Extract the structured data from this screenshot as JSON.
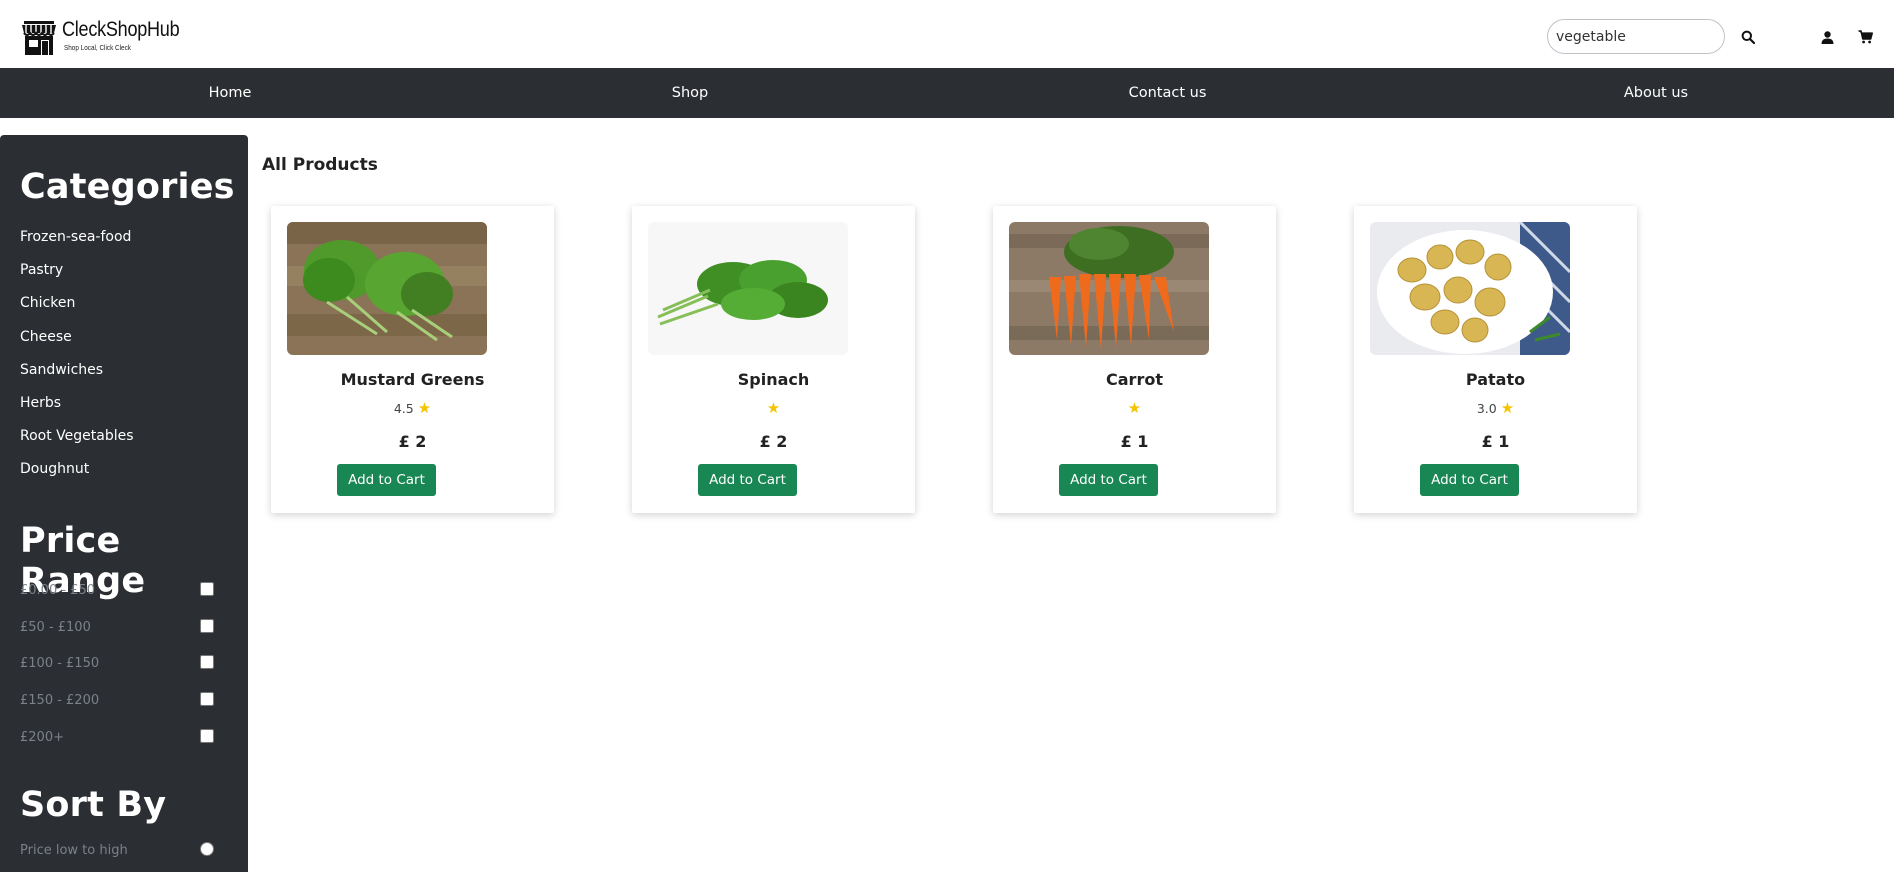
{
  "brand": {
    "name": "CleckShopHub",
    "tagline": "Shop Local, Click Cleck",
    "icon": "storefront-icon"
  },
  "header": {
    "search_value": "vegetable",
    "search_icon": "search-icon",
    "user_icon": "user-icon",
    "cart_icon": "cart-icon"
  },
  "nav": {
    "items": [
      {
        "label": "Home"
      },
      {
        "label": "Shop"
      },
      {
        "label": "Contact us"
      },
      {
        "label": "About us"
      }
    ]
  },
  "sidebar": {
    "categories_title": "Categories",
    "categories": [
      {
        "label": "Frozen-sea-food"
      },
      {
        "label": "Pastry"
      },
      {
        "label": "Chicken"
      },
      {
        "label": "Cheese"
      },
      {
        "label": "Sandwiches"
      },
      {
        "label": "Herbs"
      },
      {
        "label": "Root Vegetables"
      },
      {
        "label": "Doughnut"
      }
    ],
    "price_title": "Price Range",
    "price_ranges": [
      {
        "label": "£0.00 - £50",
        "checked": false
      },
      {
        "label": "£50 - £100",
        "checked": false
      },
      {
        "label": "£100 - £150",
        "checked": false
      },
      {
        "label": "£150 - £200",
        "checked": false
      },
      {
        "label": "£200+",
        "checked": false
      }
    ],
    "sort_title": "Sort By",
    "sort_options": [
      {
        "label": "Price low to high",
        "selected": false
      }
    ]
  },
  "main": {
    "title": "All Products",
    "products": [
      {
        "name": "Mustard Greens",
        "rating": "4.5",
        "price": "£ 2",
        "button": "Add to Cart",
        "image": "mustard-greens-photo"
      },
      {
        "name": "Spinach",
        "rating": "",
        "price": "£ 2",
        "button": "Add to Cart",
        "image": "spinach-photo"
      },
      {
        "name": "Carrot",
        "rating": "",
        "price": "£ 1",
        "button": "Add to Cart",
        "image": "carrot-photo"
      },
      {
        "name": "Patato",
        "rating": "3.0",
        "price": "£ 1",
        "button": "Add to Cart",
        "image": "potato-photo"
      }
    ]
  },
  "colors": {
    "nav_bg": "#2b2e33",
    "button_green": "#198754",
    "star_yellow": "#f5c400"
  }
}
